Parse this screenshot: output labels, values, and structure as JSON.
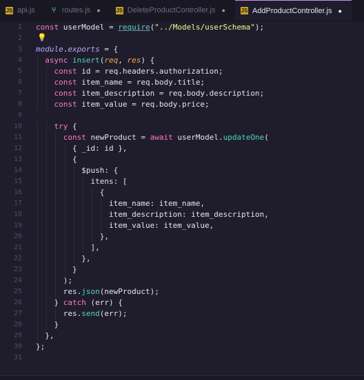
{
  "tabs": [
    {
      "label": "api.js",
      "icon": "js-file-icon",
      "active": false,
      "modified": false
    },
    {
      "label": "routes.js",
      "icon": "route-file-icon",
      "active": false,
      "modified": true
    },
    {
      "label": "DeleteProductController.js",
      "icon": "js-file-icon",
      "active": false,
      "modified": true
    },
    {
      "label": "AddProductController.js",
      "icon": "js-file-icon",
      "active": true,
      "modified": true
    }
  ],
  "tab_icon_text": "JS",
  "modified_dot": "●",
  "lightbulb": "💡",
  "colors": {
    "background": "#1f1d2b",
    "keyword": "#ff7ac6",
    "function": "#4fd6be",
    "string": "#f1fa8c",
    "active_tab_border": "#c792ea"
  },
  "lines": [
    [
      {
        "t": "const ",
        "c": "kw"
      },
      {
        "t": "userModel = "
      },
      {
        "t": "require",
        "c": "fn under"
      },
      {
        "t": "("
      },
      {
        "t": "\"../Models/userSchema\"",
        "c": "str"
      },
      {
        "t": ");"
      }
    ],
    [],
    [
      {
        "t": "module",
        "c": "mod"
      },
      {
        "t": "."
      },
      {
        "t": "exports",
        "c": "mod"
      },
      {
        "t": " = {"
      }
    ],
    [
      {
        "t": "  "
      },
      {
        "t": "async ",
        "c": "kw"
      },
      {
        "t": "insert",
        "c": "fn"
      },
      {
        "t": "("
      },
      {
        "t": "req",
        "c": "prm"
      },
      {
        "t": ", "
      },
      {
        "t": "res",
        "c": "prm"
      },
      {
        "t": ") {"
      }
    ],
    [
      {
        "t": "    "
      },
      {
        "t": "const ",
        "c": "kw"
      },
      {
        "t": "id = req.headers.authorization;"
      }
    ],
    [
      {
        "t": "    "
      },
      {
        "t": "const ",
        "c": "kw"
      },
      {
        "t": "item_name = req.body.title;"
      }
    ],
    [
      {
        "t": "    "
      },
      {
        "t": "const ",
        "c": "kw"
      },
      {
        "t": "item_description = req.body.description;"
      }
    ],
    [
      {
        "t": "    "
      },
      {
        "t": "const ",
        "c": "kw"
      },
      {
        "t": "item_value = req.body.price;"
      }
    ],
    [],
    [
      {
        "t": "    "
      },
      {
        "t": "try ",
        "c": "kw"
      },
      {
        "t": "{"
      }
    ],
    [
      {
        "t": "      "
      },
      {
        "t": "const ",
        "c": "kw"
      },
      {
        "t": "newProduct = "
      },
      {
        "t": "await ",
        "c": "kw"
      },
      {
        "t": "userModel."
      },
      {
        "t": "updateOne",
        "c": "fn"
      },
      {
        "t": "("
      }
    ],
    [
      {
        "t": "        { _id: id },"
      }
    ],
    [
      {
        "t": "        {"
      }
    ],
    [
      {
        "t": "          $push: {"
      }
    ],
    [
      {
        "t": "            itens: ["
      }
    ],
    [
      {
        "t": "              {"
      }
    ],
    [
      {
        "t": "                item_name: item_name,"
      }
    ],
    [
      {
        "t": "                item_description: item_description,"
      }
    ],
    [
      {
        "t": "                item_value: item_value,"
      }
    ],
    [
      {
        "t": "              },"
      }
    ],
    [
      {
        "t": "            ],"
      }
    ],
    [
      {
        "t": "          },"
      }
    ],
    [
      {
        "t": "        }"
      }
    ],
    [
      {
        "t": "      );"
      }
    ],
    [
      {
        "t": "      res."
      },
      {
        "t": "json",
        "c": "fn"
      },
      {
        "t": "(newProduct);"
      }
    ],
    [
      {
        "t": "    } "
      },
      {
        "t": "catch ",
        "c": "kw"
      },
      {
        "t": "(err) {"
      }
    ],
    [
      {
        "t": "      res."
      },
      {
        "t": "send",
        "c": "fn"
      },
      {
        "t": "(err);"
      }
    ],
    [
      {
        "t": "    }"
      }
    ],
    [
      {
        "t": "  },"
      }
    ],
    [
      {
        "t": "};"
      }
    ],
    []
  ]
}
